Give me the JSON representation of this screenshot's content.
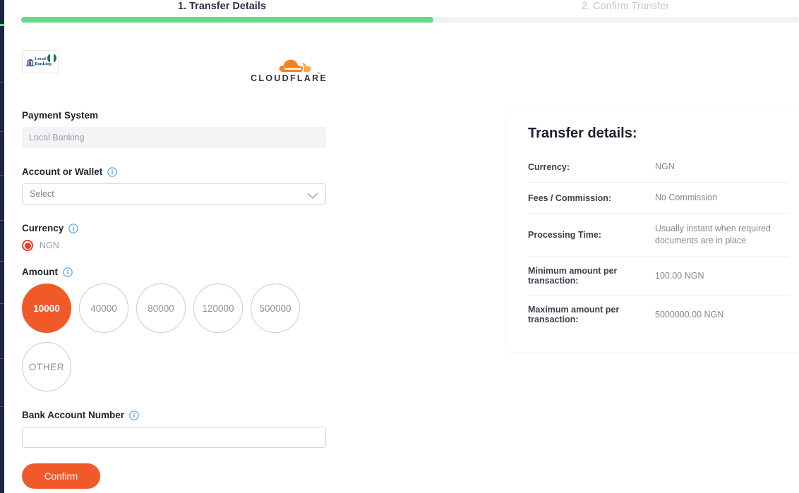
{
  "stepper": {
    "step1": "1. Transfer Details",
    "step2": "2. Confirm Transfer",
    "progress_percent": 53,
    "fill_color": "#63da8c",
    "track_color": "#f1f2f5"
  },
  "branding": {
    "local_bank": {
      "line1": "Local",
      "line2": "Banking",
      "flag": "nigeria-flag",
      "bank_icon": "bank-building-icon"
    },
    "cloudflare": {
      "wordmark": "CLOUDFLARE",
      "trademark": "™",
      "cloud_color": "#f6821f"
    }
  },
  "form": {
    "payment_system": {
      "label": "Payment System",
      "value": "Local Banking"
    },
    "account_or_wallet": {
      "label": "Account or Wallet",
      "value": "Select",
      "info": "info-icon"
    },
    "currency": {
      "label": "Currency",
      "options": [
        "NGN"
      ],
      "selected": "NGN"
    },
    "amount": {
      "label": "Amount",
      "options": [
        "10000",
        "40000",
        "80000",
        "120000",
        "500000",
        "OTHER"
      ],
      "selected": "10000",
      "selected_color": "#ef5a28"
    },
    "bank_account_number": {
      "label": "Bank Account Number",
      "value": "",
      "placeholder": ""
    },
    "confirm_label": "Confirm"
  },
  "details": {
    "title": "Transfer details:",
    "rows": [
      {
        "key": "Currency:",
        "value": "NGN"
      },
      {
        "key": "Fees / Commission:",
        "value": "No Commission"
      },
      {
        "key": "Processing Time:",
        "value": "Usually instant when required documents are in place"
      },
      {
        "key": "Minimum amount per transaction:",
        "value": "100.00 NGN"
      },
      {
        "key": "Maximum amount per transaction:",
        "value": "5000000.00 NGN"
      }
    ]
  }
}
